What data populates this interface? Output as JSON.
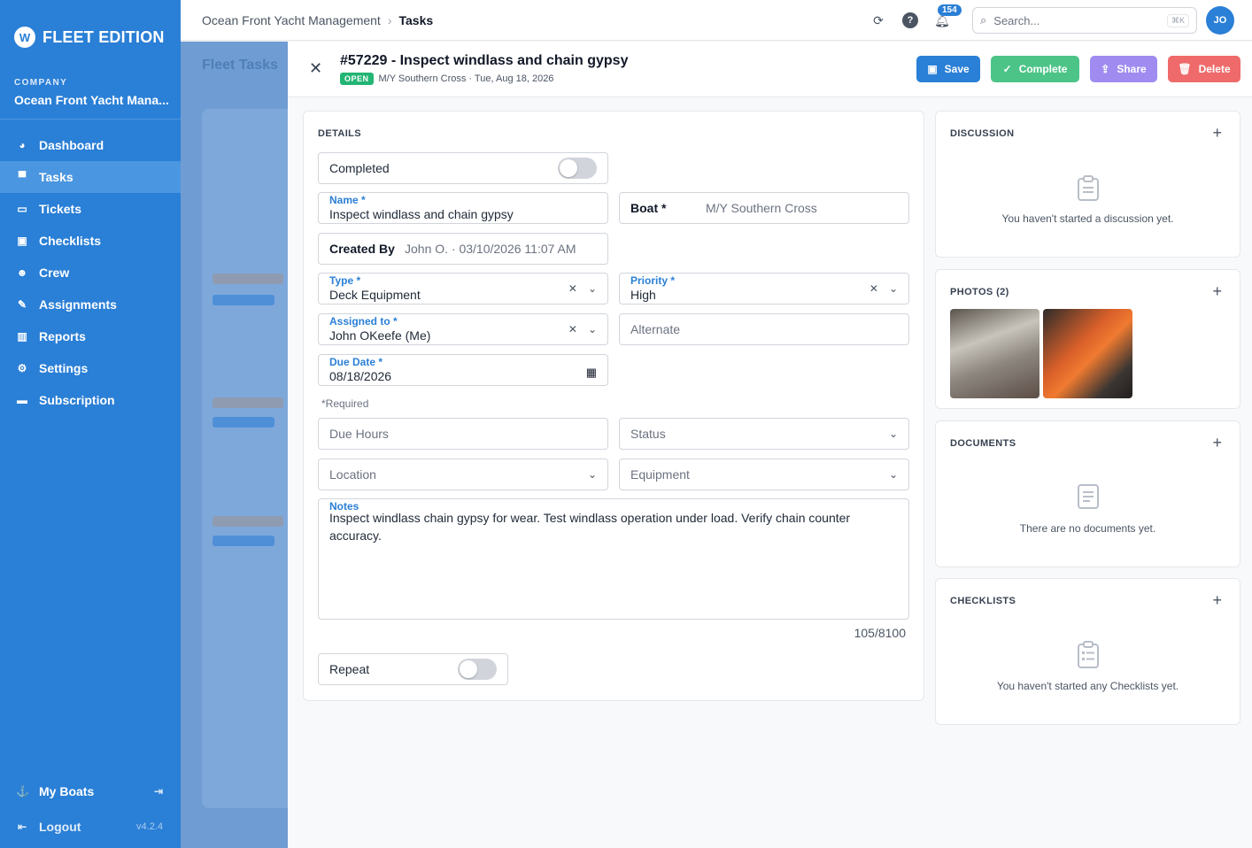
{
  "sidebar": {
    "brand": "FLEET EDITION",
    "company_label": "COMPANY",
    "company_name": "Ocean Front Yacht Mana...",
    "items": [
      {
        "label": "Dashboard",
        "icon": "dashboard-icon"
      },
      {
        "label": "Tasks",
        "icon": "tasks-icon",
        "active": true
      },
      {
        "label": "Tickets",
        "icon": "ticket-icon"
      },
      {
        "label": "Checklists",
        "icon": "checklist-icon"
      },
      {
        "label": "Crew",
        "icon": "crew-icon"
      },
      {
        "label": "Assignments",
        "icon": "assignment-icon"
      },
      {
        "label": "Reports",
        "icon": "reports-icon"
      },
      {
        "label": "Settings",
        "icon": "gear-icon"
      },
      {
        "label": "Subscription",
        "icon": "card-icon"
      }
    ],
    "my_boats": "My Boats",
    "logout": "Logout",
    "version": "v4.2.4"
  },
  "topbar": {
    "breadcrumb": [
      "Ocean Front Yacht Management",
      "Tasks"
    ],
    "notifications_count": "154",
    "search_placeholder": "Search...",
    "search_shortcut": "⌘K",
    "avatar_initials": "JO"
  },
  "backdrop": {
    "title": "Fleet Tasks"
  },
  "task": {
    "title": "#57229 - Inspect windlass and chain gypsy",
    "status": "OPEN",
    "meta": "M/Y Southern Cross · Tue, Aug 18, 2026",
    "buttons": {
      "save": "Save",
      "complete": "Complete",
      "share": "Share",
      "delete": "Delete"
    }
  },
  "details": {
    "section": "DETAILS",
    "completed_label": "Completed",
    "completed": false,
    "name_label": "Name *",
    "name_value": "Inspect windlass and chain gypsy",
    "boat_label": "Boat *",
    "boat_value": "M/Y Southern Cross",
    "created_label": "Created By",
    "created_value": "John O. · 03/10/2026 11:07 AM",
    "type_label": "Type *",
    "type_value": "Deck Equipment",
    "priority_label": "Priority *",
    "priority_value": "High",
    "assigned_label": "Assigned to *",
    "assigned_value": "John OKeefe (Me)",
    "alternate_placeholder": "Alternate",
    "due_date_label": "Due Date *",
    "due_date_value": "08/18/2026",
    "required_note": "*Required",
    "due_hours_placeholder": "Due Hours",
    "status_placeholder": "Status",
    "location_placeholder": "Location",
    "equipment_placeholder": "Equipment",
    "notes_label": "Notes",
    "notes_value": "Inspect windlass chain gypsy for wear. Test windlass operation under load. Verify chain counter accuracy.",
    "notes_counter": "105/8100",
    "repeat_label": "Repeat",
    "repeat": false
  },
  "discussion": {
    "title": "DISCUSSION",
    "empty": "You haven't started a discussion yet."
  },
  "photos": {
    "title": "PHOTOS (2)"
  },
  "documents": {
    "title": "DOCUMENTS",
    "empty": "There are no documents yet."
  },
  "checklists": {
    "title": "CHECKLISTS",
    "empty": "You haven't started any Checklists yet."
  },
  "colors": {
    "primary": "#2a7fd6",
    "success": "#4cc488",
    "share": "#a08cf0",
    "danger": "#ef6a6a"
  }
}
